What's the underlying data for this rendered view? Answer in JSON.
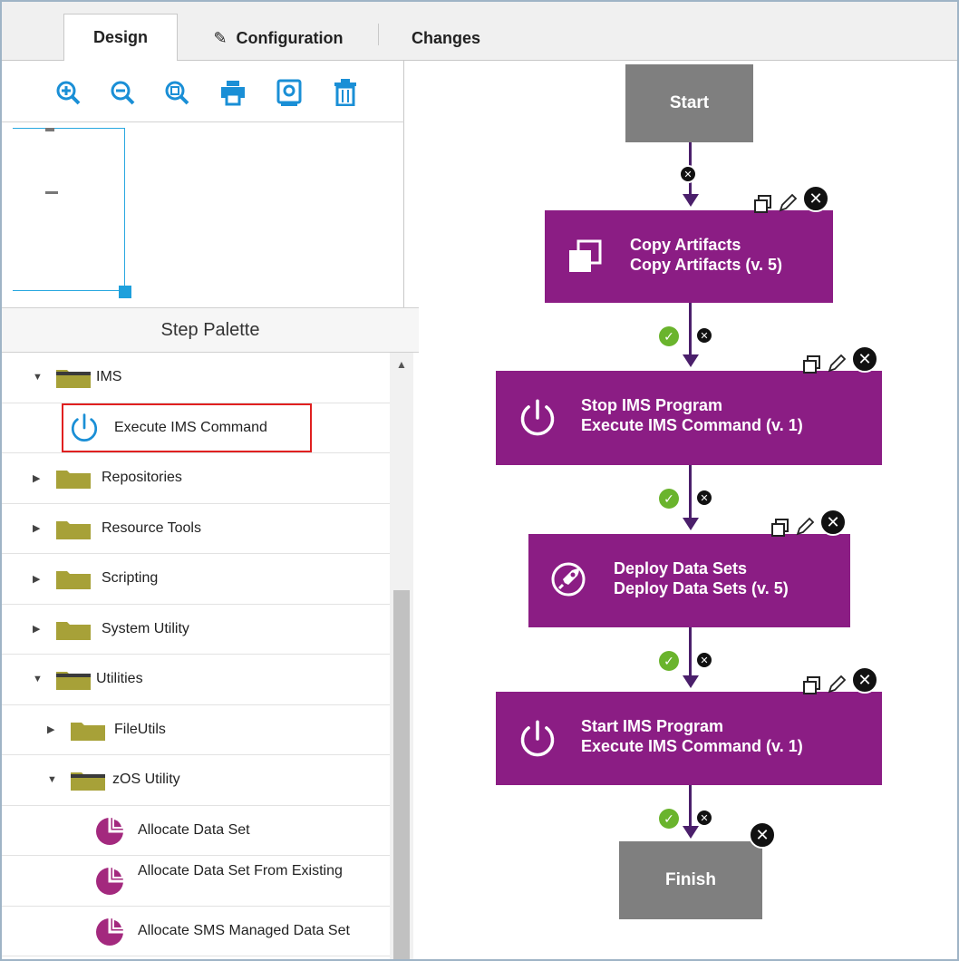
{
  "tabs": [
    {
      "label": "Design",
      "active": true
    },
    {
      "label": "Configuration",
      "icon": "pencil-icon"
    },
    {
      "label": "Changes"
    }
  ],
  "toolbar": {
    "icons": [
      "zoom-in-icon",
      "zoom-out-icon",
      "zoom-fit-icon",
      "print-icon",
      "export-icon",
      "delete-icon"
    ],
    "accent": "#1a8fd6"
  },
  "palette": {
    "title": "Step Palette",
    "items": [
      {
        "label": "IMS",
        "type": "folder",
        "expanded": true,
        "level": 0
      },
      {
        "label": "Execute IMS Command",
        "type": "step",
        "icon": "power-icon",
        "level": 1,
        "selected": true
      },
      {
        "label": "Repositories",
        "type": "folder",
        "expanded": false,
        "level": 0
      },
      {
        "label": "Resource Tools",
        "type": "folder",
        "expanded": false,
        "level": 0
      },
      {
        "label": "Scripting",
        "type": "folder",
        "expanded": false,
        "level": 0
      },
      {
        "label": "System Utility",
        "type": "folder",
        "expanded": false,
        "level": 0
      },
      {
        "label": "Utilities",
        "type": "folder",
        "expanded": true,
        "level": 0
      },
      {
        "label": "FileUtils",
        "type": "folder",
        "expanded": false,
        "level": 1
      },
      {
        "label": "zOS Utility",
        "type": "folder",
        "expanded": true,
        "level": 1
      },
      {
        "label": "Allocate Data Set",
        "type": "step",
        "icon": "pie-icon",
        "level": 2
      },
      {
        "label": "Allocate Data Set From Existing",
        "type": "step",
        "icon": "pie-icon",
        "level": 2
      },
      {
        "label": "Allocate SMS Managed Data Set",
        "type": "step",
        "icon": "pie-icon",
        "level": 2
      }
    ]
  },
  "flow": {
    "start": "Start",
    "finish": "Finish",
    "steps": [
      {
        "name": "Copy Artifacts",
        "detail": "Copy Artifacts (v. 5)",
        "icon": "copy-icon"
      },
      {
        "name": "Stop IMS Program",
        "detail": "Execute IMS Command (v. 1)",
        "icon": "power-icon"
      },
      {
        "name": "Deploy Data Sets",
        "detail": "Deploy Data Sets (v. 5)",
        "icon": "rocket-icon"
      },
      {
        "name": "Start IMS Program",
        "detail": "Execute IMS Command (v. 1)",
        "icon": "power-icon"
      }
    ],
    "colors": {
      "step": "#8b1d84",
      "terminal": "#7f7f7f",
      "connector": "#4b1f6b",
      "success": "#6ab42d"
    }
  }
}
